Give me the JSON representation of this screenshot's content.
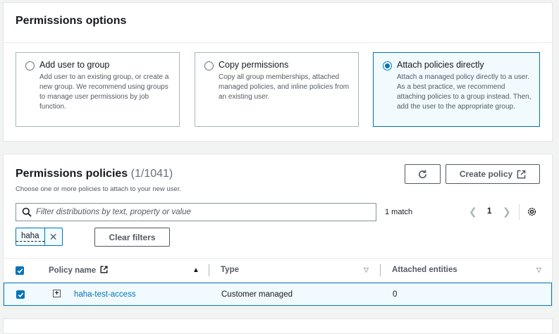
{
  "permissions_options": {
    "title": "Permissions options",
    "options": [
      {
        "label": "Add user to group",
        "description": "Add user to an existing group, or create a new group. We recommend using groups to manage user permissions by job function.",
        "selected": false
      },
      {
        "label": "Copy permissions",
        "description": "Copy all group memberships, attached managed policies, and inline policies from an existing user.",
        "selected": false
      },
      {
        "label": "Attach policies directly",
        "description": "Attach a managed policy directly to a user. As a best practice, we recommend attaching policies to a group instead. Then, add the user to the appropriate group.",
        "selected": true
      }
    ]
  },
  "permissions_policies": {
    "title": "Permissions policies",
    "count": "(1/1041)",
    "subtitle": "Choose one or more policies to attach to your new user.",
    "refresh_icon": "refresh-icon",
    "create_policy_label": "Create policy",
    "search": {
      "placeholder": "Filter distributions by text, property or value",
      "value": ""
    },
    "match_text": "1 match",
    "page": "1",
    "filter_token": "haha",
    "clear_filters_label": "Clear filters",
    "table": {
      "columns": [
        "Policy name",
        "Type",
        "Attached entities"
      ],
      "rows": [
        {
          "name": "haha-test-access",
          "type": "Customer managed",
          "attached": "0",
          "selected": true
        }
      ]
    }
  },
  "colors": {
    "accent": "#0073bb",
    "selected_bg": "#f1faff",
    "page_bg": "#f2f3f3"
  }
}
